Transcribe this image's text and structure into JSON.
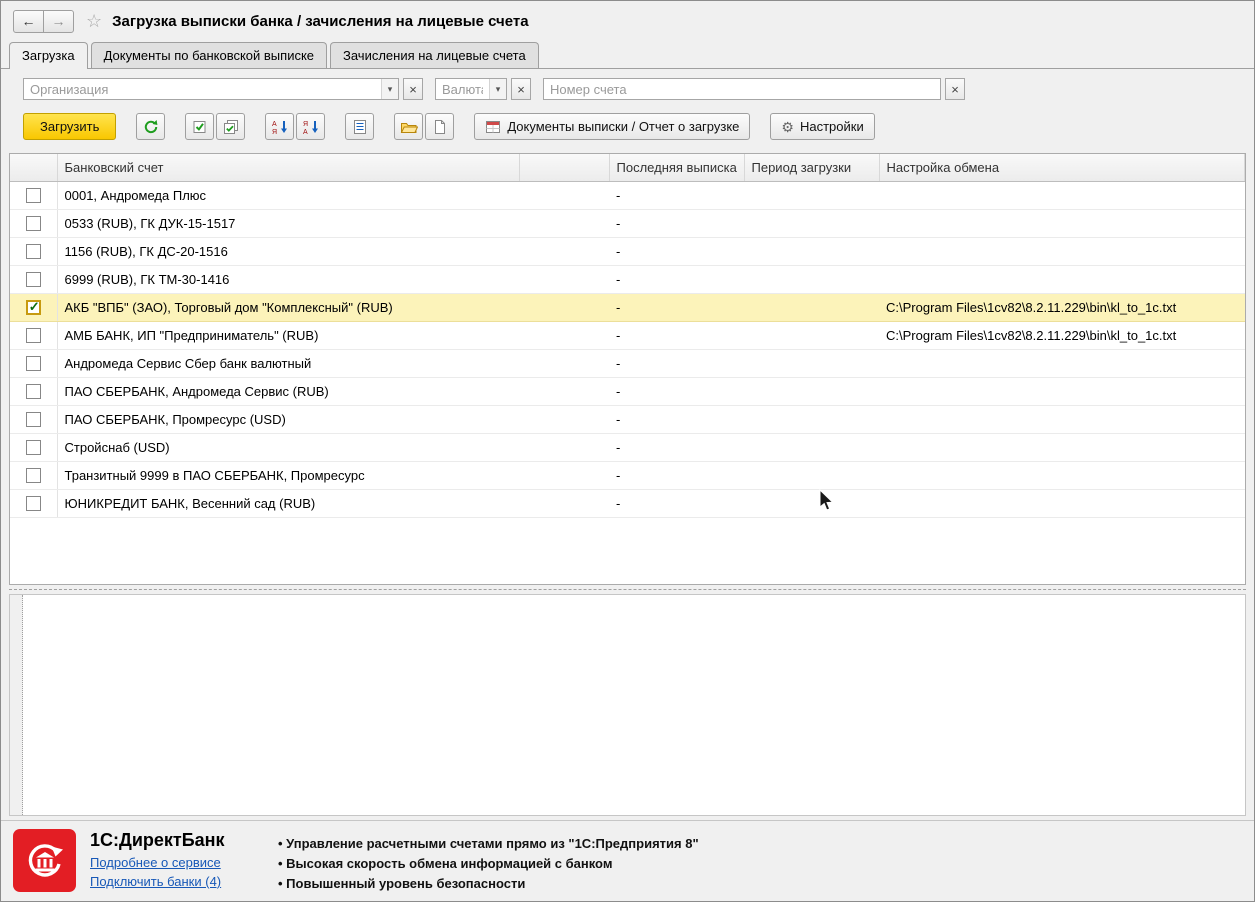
{
  "icons": {
    "back": "←",
    "forward": "→",
    "star": "☆",
    "dropdown": "▾",
    "clear": "×",
    "gear": "⚙"
  },
  "header": {
    "title": "Загрузка выписки банка / зачисления на лицевые счета"
  },
  "tabs": [
    {
      "label": "Загрузка"
    },
    {
      "label": "Документы по банковской выписке"
    },
    {
      "label": "Зачисления на лицевые счета"
    }
  ],
  "filters": {
    "organization": {
      "placeholder": "Организация",
      "value": ""
    },
    "currency": {
      "placeholder": "Валюта",
      "value": ""
    },
    "account_number": {
      "placeholder": "Номер счета",
      "value": ""
    }
  },
  "toolbar": {
    "load": "Загрузить",
    "statement_docs": "Документы выписки / Отчет о загрузке",
    "settings": "Настройки"
  },
  "table": {
    "columns": {
      "account": "Банковский счет",
      "last_statement": "Последняя выписка",
      "load_period": "Период загрузки",
      "exchange_settings": "Настройка обмена"
    },
    "rows": [
      {
        "checked": false,
        "account": "0001, Андромеда Плюс",
        "last": "-",
        "period": "",
        "exchange": ""
      },
      {
        "checked": false,
        "account": "0533 (RUB), ГК ДУК-15-1517",
        "last": "-",
        "period": "",
        "exchange": ""
      },
      {
        "checked": false,
        "account": "1156 (RUB), ГК ДС-20-1516",
        "last": "-",
        "period": "",
        "exchange": ""
      },
      {
        "checked": false,
        "account": "6999 (RUB), ГК ТМ-30-1416",
        "last": "-",
        "period": "",
        "exchange": ""
      },
      {
        "checked": true,
        "account": "АКБ \"ВПБ\" (ЗАО), Торговый дом \"Комплексный\" (RUB)",
        "last": "-",
        "period": "",
        "exchange": "C:\\Program Files\\1cv82\\8.2.11.229\\bin\\kl_to_1c.txt"
      },
      {
        "checked": false,
        "account": "АМБ БАНК, ИП \"Предприниматель\" (RUB)",
        "last": "-",
        "period": "",
        "exchange": "C:\\Program Files\\1cv82\\8.2.11.229\\bin\\kl_to_1c.txt"
      },
      {
        "checked": false,
        "account": "Андромеда Сервис Сбер банк валютный",
        "last": "-",
        "period": "",
        "exchange": ""
      },
      {
        "checked": false,
        "account": "ПАО СБЕРБАНК, Андромеда Сервис (RUB)",
        "last": "-",
        "period": "",
        "exchange": ""
      },
      {
        "checked": false,
        "account": "ПАО СБЕРБАНК, Промресурс (USD)",
        "last": "-",
        "period": "",
        "exchange": ""
      },
      {
        "checked": false,
        "account": "Стройснаб (USD)",
        "last": "-",
        "period": "",
        "exchange": ""
      },
      {
        "checked": false,
        "account": "Транзитный 9999 в ПАО СБЕРБАНК, Промресурс",
        "last": "-",
        "period": "",
        "exchange": ""
      },
      {
        "checked": false,
        "account": "ЮНИКРЕДИТ БАНК, Весенний сад (RUB)",
        "last": "-",
        "period": "",
        "exchange": ""
      }
    ]
  },
  "footer": {
    "brand": "1С:ДиректБанк",
    "about_link": "Подробнее о сервисе",
    "connect_link": "Подключить банки (4)",
    "bullets": [
      "Управление расчетными счетами прямо из \"1С:Предприятия 8\"",
      "Высокая скорость обмена информацией с банком",
      "Повышенный уровень безопасности"
    ]
  }
}
